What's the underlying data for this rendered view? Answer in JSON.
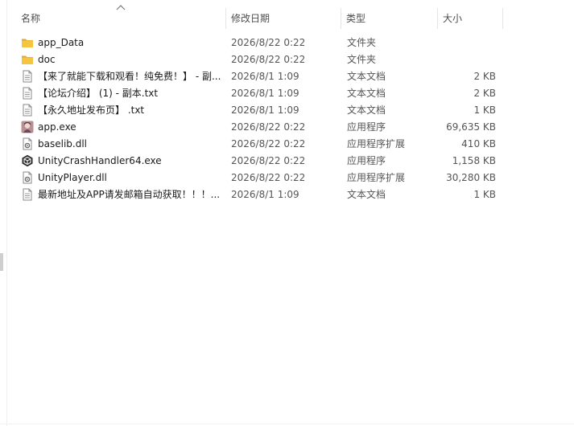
{
  "columns": {
    "name": "名称",
    "date": "修改日期",
    "type": "类型",
    "size": "大小"
  },
  "files": [
    {
      "name": "app_Data",
      "date": "2026/8/22 0:22",
      "type": "文件夹",
      "size": "",
      "icon": "folder-icon"
    },
    {
      "name": "doc",
      "date": "2026/8/22 0:22",
      "type": "文件夹",
      "size": "",
      "icon": "folder-icon"
    },
    {
      "name": "【来了就能下载和观看！纯免费！】 - 副...",
      "date": "2026/8/1 1:09",
      "type": "文本文档",
      "size": "2 KB",
      "icon": "text-file-icon"
    },
    {
      "name": "【论坛介绍】 (1) - 副本.txt",
      "date": "2026/8/1 1:09",
      "type": "文本文档",
      "size": "2 KB",
      "icon": "text-file-icon"
    },
    {
      "name": "【永久地址发布页】 .txt",
      "date": "2026/8/1 1:09",
      "type": "文本文档",
      "size": "1 KB",
      "icon": "text-file-icon"
    },
    {
      "name": "app.exe",
      "date": "2026/8/22 0:22",
      "type": "应用程序",
      "size": "69,635 KB",
      "icon": "app-exe-icon"
    },
    {
      "name": "baselib.dll",
      "date": "2026/8/22 0:22",
      "type": "应用程序扩展",
      "size": "410 KB",
      "icon": "dll-icon"
    },
    {
      "name": "UnityCrashHandler64.exe",
      "date": "2026/8/22 0:22",
      "type": "应用程序",
      "size": "1,158 KB",
      "icon": "unity-icon"
    },
    {
      "name": "UnityPlayer.dll",
      "date": "2026/8/22 0:22",
      "type": "应用程序扩展",
      "size": "30,280 KB",
      "icon": "dll-icon"
    },
    {
      "name": "最新地址及APP请发邮箱自动获取！！！...",
      "date": "2026/8/1 1:09",
      "type": "文本文档",
      "size": "1 KB",
      "icon": "text-file-icon"
    }
  ],
  "colors": {
    "folder": "#f5c542",
    "folder_dark": "#e0a82e",
    "header_text": "#4d4d4d"
  }
}
